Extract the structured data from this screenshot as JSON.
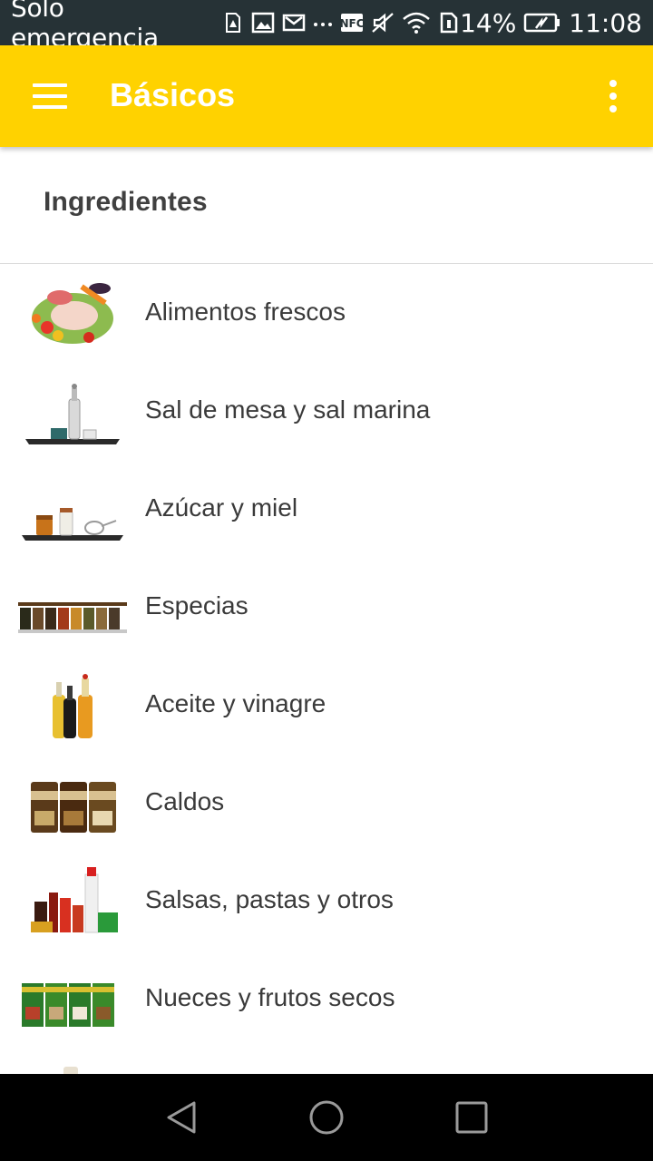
{
  "status_bar": {
    "carrier": "Solo emergencia",
    "icons": [
      "sim-alert-icon",
      "image-icon",
      "mail-icon",
      "more-dots-icon",
      "nfc-icon",
      "mute-icon",
      "wifi-icon",
      "data-sim-icon"
    ],
    "battery": "14%",
    "time": "11:08"
  },
  "app_bar": {
    "title": "Básicos",
    "color": "#ffd200"
  },
  "section": {
    "title": "Ingredientes"
  },
  "items": [
    {
      "label": "Alimentos frescos",
      "thumb": "fresh-food"
    },
    {
      "label": "Sal de mesa y sal marina",
      "thumb": "salt"
    },
    {
      "label": "Azúcar y miel",
      "thumb": "sugar-honey"
    },
    {
      "label": "Especias",
      "thumb": "spices"
    },
    {
      "label": "Aceite y vinagre",
      "thumb": "oil-vinegar"
    },
    {
      "label": "Caldos",
      "thumb": "broths"
    },
    {
      "label": "Salsas, pastas y otros",
      "thumb": "sauces"
    },
    {
      "label": "Nueces y frutos secos",
      "thumb": "nuts"
    }
  ],
  "nav": {
    "icons": [
      "back-icon",
      "home-icon",
      "recents-icon"
    ]
  }
}
